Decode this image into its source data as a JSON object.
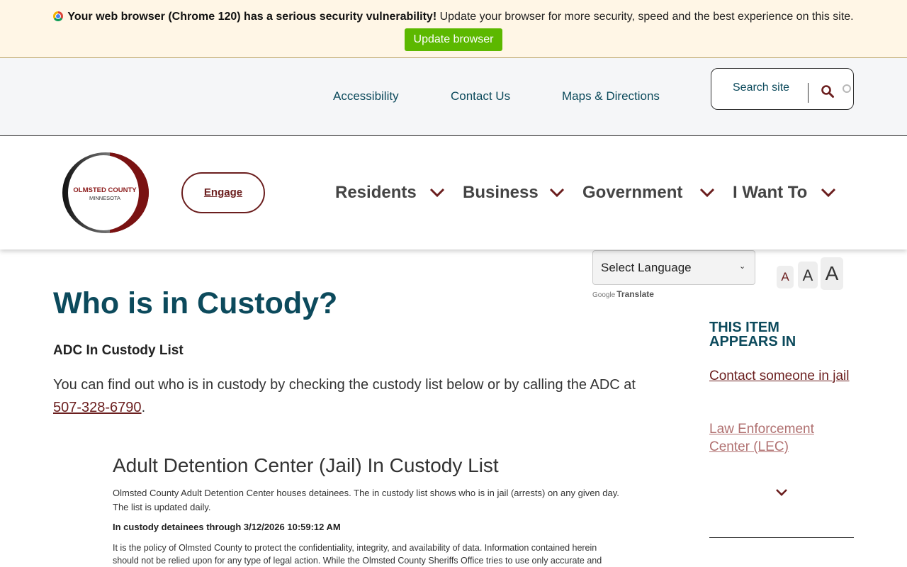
{
  "banner": {
    "warning_bold": "Your web browser (Chrome 120) has a serious security vulnerability!",
    "warning_text": " Update your browser for more security, speed and the best experience on this site.",
    "update_button": "Update browser",
    "colors": {
      "background": "#fff6e6",
      "button": "#5cb800"
    }
  },
  "utility": {
    "links": [
      "Accessibility",
      "Contact Us",
      "Maps & Directions"
    ],
    "search": {
      "placeholder": "Search site",
      "icon": "search-icon"
    }
  },
  "header": {
    "logo": {
      "line1": "OLMSTED COUNTY",
      "line2": "MINNESOTA"
    },
    "engage_label": "Engage",
    "nav": [
      {
        "label": "Residents",
        "icon": "chevron-down-icon"
      },
      {
        "label": "Business",
        "icon": "chevron-down-icon"
      },
      {
        "label": "Government",
        "icon": "chevron-down-icon"
      },
      {
        "label": "I Want To",
        "icon": "chevron-down-icon"
      }
    ]
  },
  "translate": {
    "select_label": "Select Language",
    "credit_google": "Google",
    "credit_translate": "Translate"
  },
  "font_size": {
    "labels": [
      "A",
      "A",
      "A"
    ]
  },
  "content": {
    "title": "Who is in Custody?",
    "subhead": "ADC In Custody List",
    "intro_text": "You can find out who is in custody by checking the custody list below or by calling the ADC at ",
    "phone": "507-328-6790",
    "intro_end": "."
  },
  "embed": {
    "title": "Adult Detention Center (Jail) In Custody List",
    "description": "Olmsted County Adult Detention Center houses detainees. The in custody list shows who is in jail (arrests) on any given day.  The list is updated daily.",
    "date_line": "In custody detainees through 3/12/2026 10:59:12 AM",
    "policy": "It is the policy of Olmsted County to protect the confidentiality, integrity, and availability of data. Information contained herein should not be relied upon for any type of legal action. While the Olmsted County Sheriffs Office tries to use only accurate and"
  },
  "sidebar": {
    "heading": "THIS ITEM APPEARS IN",
    "links": [
      "Contact someone in jail",
      "Law Enforcement Center (LEC)"
    ]
  },
  "colors": {
    "brand_teal": "#0c4a5c",
    "brand_maroon": "#6b1e1e"
  }
}
